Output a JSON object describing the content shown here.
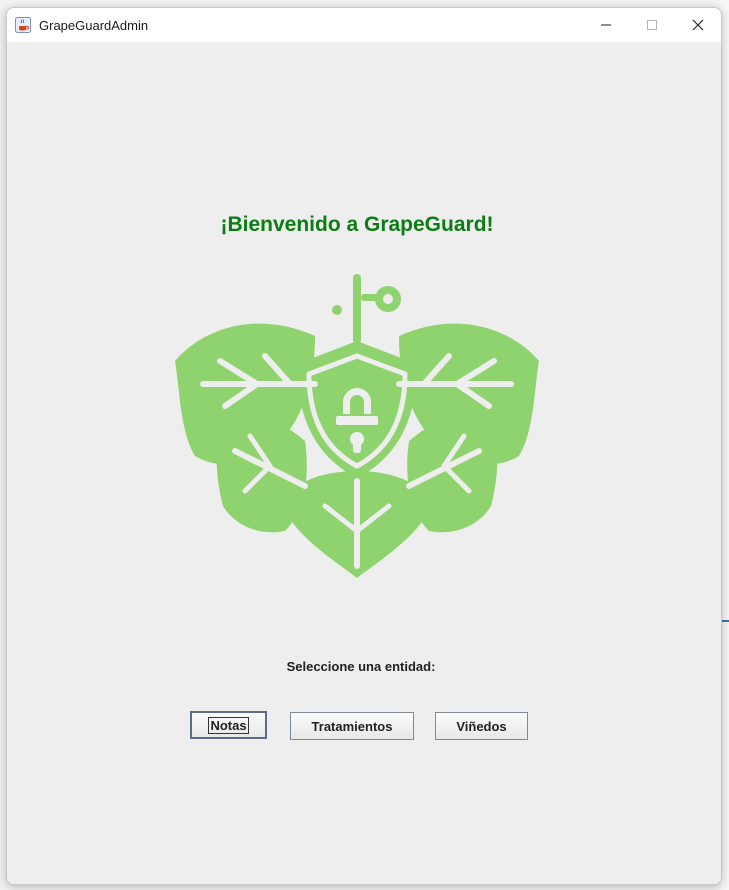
{
  "window": {
    "title": "GrapeGuardAdmin",
    "app_icon": "java-cup-icon",
    "controls": [
      "minimize-icon",
      "maximize-icon",
      "close-icon"
    ]
  },
  "main": {
    "welcome": "¡Bienvenido a GrapeGuard!",
    "logo": "grape-leaf-shield-lock-logo",
    "prompt": "Seleccione una entidad:",
    "buttons": {
      "notas": "Notas",
      "tratamientos": "Tratamientos",
      "vinedos": "Viñedos"
    }
  },
  "colors": {
    "welcome_text": "#0b7d12",
    "logo_fill": "#8fd36f",
    "window_bg": "#eeeeee"
  }
}
